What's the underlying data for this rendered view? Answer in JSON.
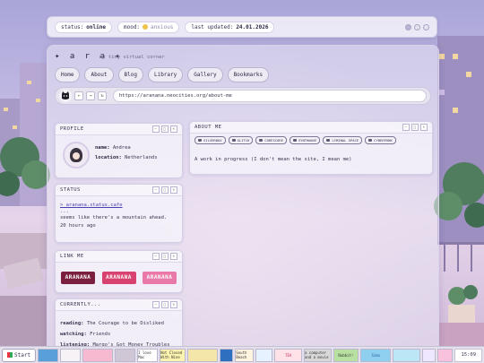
{
  "status_bar": {
    "status_label": "status:",
    "status_value": "online",
    "mood_label": "mood:",
    "mood_value": "anxious",
    "updated_label": "last updated:",
    "updated_value": "24.01.2026"
  },
  "header": {
    "brand": "✦ a r a ✦",
    "tagline": "my tiny virtual corner"
  },
  "nav": [
    "Home",
    "About",
    "Blog",
    "Library",
    "Gallery",
    "Bookmarks"
  ],
  "browser": {
    "back": "←",
    "forward": "→",
    "refresh": "↻",
    "url": "https://aranana.neocities.org/about-me"
  },
  "panel_controls": [
    "–",
    "□",
    "×"
  ],
  "profile": {
    "title": "PROFILE",
    "name_label": "name:",
    "name_value": "Andrea",
    "location_label": "location:",
    "location_value": "Netherlands"
  },
  "status_panel": {
    "title": "STATUS",
    "link": "> aranana.status.cafe",
    "dots": "...",
    "message": "seems like there's a mountain ahead.",
    "time": "20 hours ago"
  },
  "link_me": {
    "title": "LINK ME",
    "badges": [
      {
        "text": "ARANANA",
        "color": "#7a1f3e"
      },
      {
        "text": "ARANANA",
        "color": "#d7426e"
      },
      {
        "text": "ARANANA",
        "color": "#e879a8"
      }
    ]
  },
  "currently": {
    "title": "CURRENTLY...",
    "reading_label": "reading:",
    "reading_value": "The Courage to be Disliked",
    "watching_label": "watching:",
    "watching_value": "Friends",
    "listening_label": "listening:",
    "listening_value": "Margo's Got Money Troubles"
  },
  "about": {
    "title": "ABOUT ME",
    "tags": [
      "SILVERBOX",
      "GLITCH",
      "CORESCORE",
      "SYNTHWAVE",
      "LIMINAL SPACE",
      "CYBERPUNK"
    ],
    "text": "A work in progress (I don't mean the site, I mean me)"
  },
  "taskbar": {
    "start": "Start",
    "buttons": [
      {
        "label": "",
        "bg": "#5aa0d8"
      },
      {
        "label": "",
        "bg": "#f6f2f6"
      },
      {
        "label": "",
        "bg": "#f7b9d0"
      },
      {
        "label": "",
        "bg": "#cfc7d6"
      },
      {
        "label": "I love Mac",
        "bg": "#ffffff"
      },
      {
        "label": "Not Closed With Nine",
        "bg": "#fdf3b0"
      },
      {
        "label": "",
        "bg": "#f4e6a8"
      },
      {
        "label": "",
        "bg": "#2f6fbf"
      },
      {
        "label": "South Beach",
        "bg": "#fff4e0"
      },
      {
        "label": "",
        "bg": "#e6f2ff"
      },
      {
        "label": "TEA",
        "bg": "#ffe1e8"
      },
      {
        "label": "a computer and a movie",
        "bg": "#d8d8d8"
      },
      {
        "label": "Nubbit!",
        "bg": "#b8e0a0"
      },
      {
        "label": "Sims",
        "bg": "#8fd0f0"
      },
      {
        "label": "",
        "bg": "#bce6f5"
      },
      {
        "label": "",
        "bg": "#efe7ff"
      },
      {
        "label": "",
        "bg": "#f9c1dc"
      }
    ],
    "clock": "15:09"
  },
  "colors": {
    "accent": "#4a3f78",
    "panel_bg": "#f5f3fa",
    "sky_top": "#a9a6d8",
    "sky_bottom": "#e6d4ea"
  }
}
